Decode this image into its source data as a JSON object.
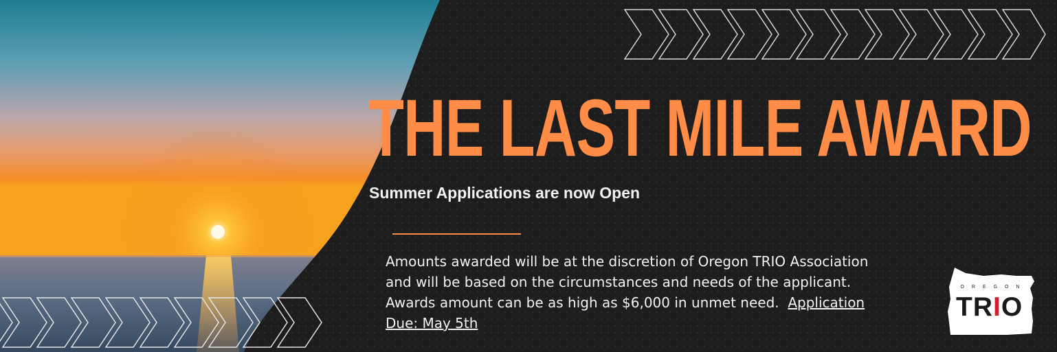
{
  "banner": {
    "title": "THE LAST MILE AWARD",
    "subtitle": "Summer Applications are now Open",
    "body_text": "Amounts awarded will be at the discretion of Oregon TRIO Association and will be based on the circumstances and needs of the applicant. Awards amount can be as high as $6,000 in unmet need.",
    "due_link": "Application Due: May 5th"
  },
  "logo": {
    "small_text": "OREGON",
    "word_part1": "TR",
    "word_accent": "I",
    "word_part2": "O"
  },
  "colors": {
    "accent": "#ff8c47",
    "background": "#1d1d1d",
    "text": "#f2f2f2",
    "logo_red": "#d21f2b"
  },
  "icons": [
    "chevron-row-top",
    "chevron-row-bottom",
    "oregon-state-shape"
  ]
}
